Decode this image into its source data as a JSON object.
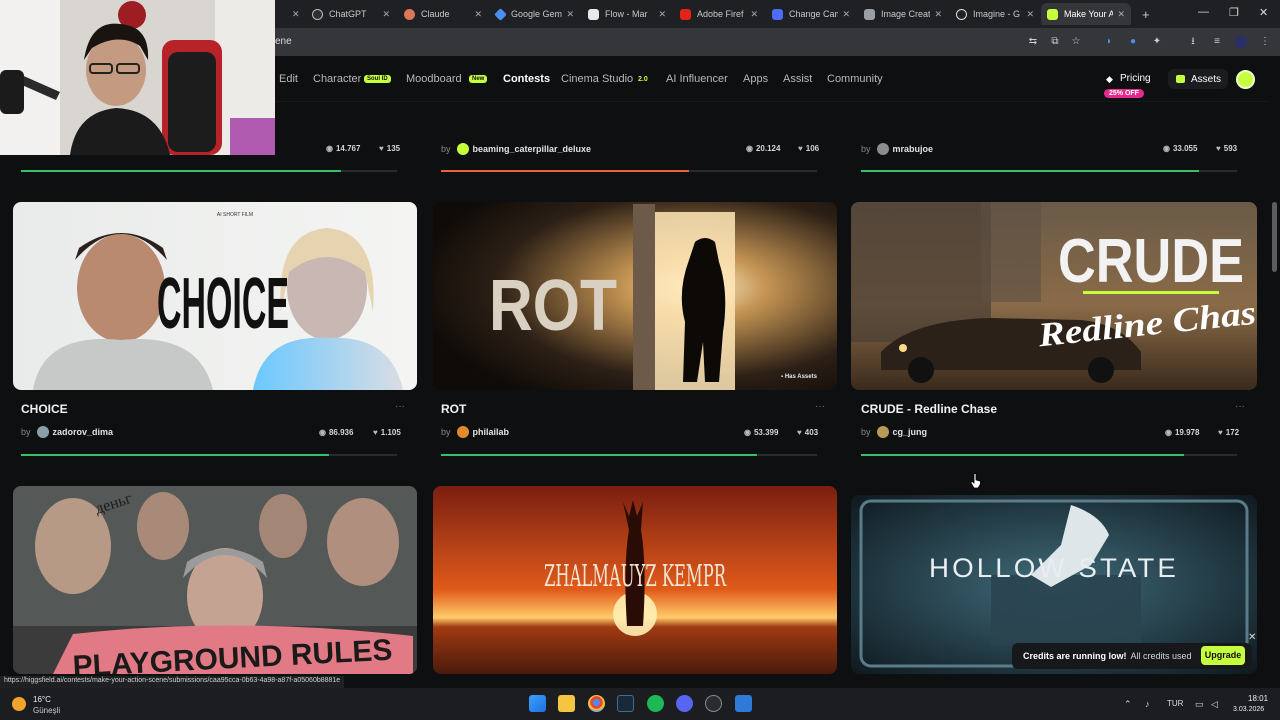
{
  "browser": {
    "tabs": [
      {
        "title": "ChatGPT",
        "color": "#2f2f2f"
      },
      {
        "title": "Claude",
        "color": "#d97757"
      },
      {
        "title": "Google Gem",
        "color": "#4b8ef0"
      },
      {
        "title": "Flow - Mar",
        "color": "#e9e9e9"
      },
      {
        "title": "Adobe Firef",
        "color": "#e2231a"
      },
      {
        "title": "Change Cam",
        "color": "#4d6bfe"
      },
      {
        "title": "Image Creat",
        "color": "#9aa0a6"
      },
      {
        "title": "Imagine - G",
        "color": "#e8e8e8"
      },
      {
        "title": "Make Your A",
        "color": "#c6ff3d"
      }
    ],
    "url_fragment": "cene",
    "status_url": "https://higgsfield.ai/contests/make-your-action-scene/submissions/caa95cca-0b63-4a98-a87f-a05060b8881e"
  },
  "nav": {
    "items": [
      "Edit",
      "Character",
      "Moodboard",
      "Contests",
      "Cinema Studio",
      "AI Influencer",
      "Apps",
      "Assist",
      "Community"
    ],
    "character_badge": "Soul ID",
    "moodboard_badge": "New",
    "cinema_badge": "2.0",
    "pricing": "Pricing",
    "discount": "25% OFF",
    "assets": "Assets"
  },
  "top_row": [
    {
      "author": "",
      "views": "14.767",
      "likes": "135",
      "progress": 0.85,
      "bar_color": "#37c06a"
    },
    {
      "author": "beaming_caterpillar_deluxe",
      "views": "20.124",
      "likes": "106",
      "progress": 0.66,
      "bar_color": "#e8623a",
      "avatar": "#c6ff3d"
    },
    {
      "author": "mrabujoe",
      "views": "33.055",
      "likes": "593",
      "progress": 0.9,
      "bar_color": "#37c06a",
      "avatar": "#8c8c8c"
    }
  ],
  "cards": [
    {
      "title": "CHOICE",
      "author": "zadorov_dima",
      "views": "86.936",
      "likes": "1.105",
      "progress": 0.82,
      "bar_color": "#37c06a",
      "avatar": "#8aa0a8"
    },
    {
      "title": "ROT",
      "author": "philailab",
      "views": "53.399",
      "likes": "403",
      "progress": 0.84,
      "bar_color": "#37c06a",
      "avatar": "#e08a2c",
      "badge": "Has Assets"
    },
    {
      "title": "CRUDE - Redline Chase",
      "author": "cg_jung",
      "views": "19.978",
      "likes": "172",
      "progress": 0.86,
      "bar_color": "#37c06a",
      "avatar": "#b79a5a"
    }
  ],
  "posters": {
    "choice": {
      "top": "AI SHORT FILM",
      "word": "CHOICE"
    },
    "rot": {
      "word": "ROT"
    },
    "crude": {
      "word": "CRUDE",
      "sub": "Redline Chase"
    },
    "playground": {
      "top": "деньг",
      "word": "PLAYGROUND RULES"
    },
    "zhalma": {
      "word": "ZHALMAUYZ KEMPR"
    },
    "hollow": {
      "word": "HOLLOW STATE"
    }
  },
  "toast": {
    "bold": "Credits are running low!",
    "text": "All credits used",
    "button": "Upgrade"
  },
  "taskbar": {
    "temp": "16°C",
    "weather": "Güneşli",
    "lang": "TUR",
    "time": "18:01",
    "date": "3.03.2026"
  }
}
